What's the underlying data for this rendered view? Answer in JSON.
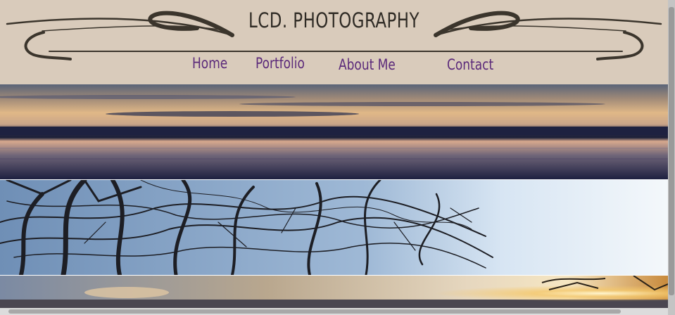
{
  "site": {
    "title": "LCD. PHOTOGRAPHY"
  },
  "nav": {
    "items": [
      {
        "label": "Home"
      },
      {
        "label": "Portfolio"
      },
      {
        "label": "About Me"
      },
      {
        "label": "Contact"
      }
    ]
  },
  "colors": {
    "header_bg": "#d9cbbb",
    "title_text": "#2f2b25",
    "nav_link": "#5b2a7a",
    "ornament": "#3b352c"
  },
  "banners": [
    {
      "subject": "sunset-over-calm-water"
    },
    {
      "subject": "bare-tree-branches-against-sky"
    },
    {
      "subject": "sunset-over-horizon"
    }
  ]
}
